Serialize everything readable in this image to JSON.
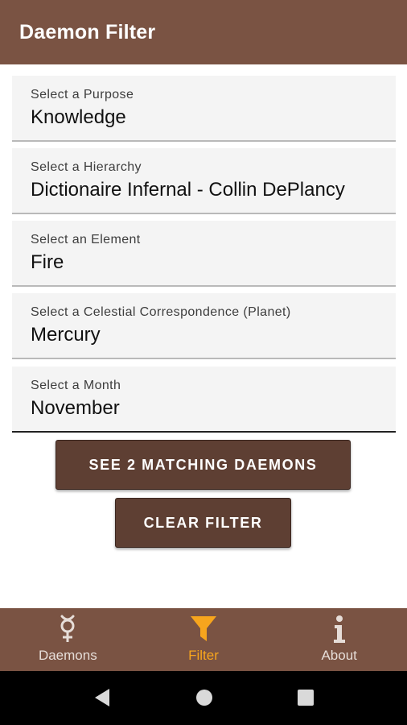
{
  "app_bar": {
    "title": "Daemon Filter"
  },
  "filters": [
    {
      "label": "Select a Purpose",
      "value": "Knowledge"
    },
    {
      "label": "Select a Hierarchy",
      "value": "Dictionaire Infernal - Collin DePlancy"
    },
    {
      "label": "Select an Element",
      "value": "Fire"
    },
    {
      "label": "Select a Celestial Correspondence (Planet)",
      "value": "Mercury"
    },
    {
      "label": "Select a Month",
      "value": "November"
    }
  ],
  "actions": {
    "see_matching_label": "SEE 2 MATCHING DAEMONS",
    "clear_filter_label": "CLEAR FILTER"
  },
  "bottom_nav": {
    "items": [
      {
        "label": "Daemons",
        "icon": "mercury-symbol-icon"
      },
      {
        "label": "Filter",
        "icon": "filter-funnel-icon"
      },
      {
        "label": "About",
        "icon": "info-icon"
      }
    ],
    "selected": "Filter"
  },
  "colors": {
    "primary": "#7a5343",
    "button": "#5e3f33",
    "accent": "#f7a51d",
    "field_background": "#f4f4f4"
  }
}
